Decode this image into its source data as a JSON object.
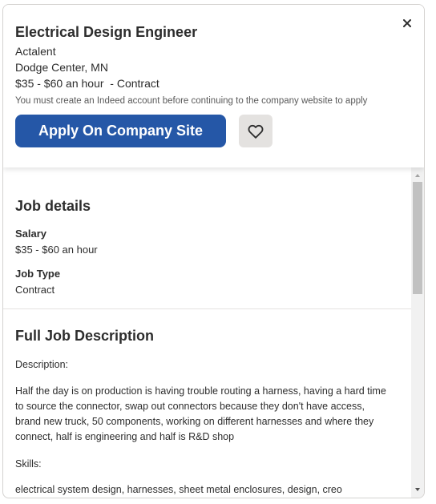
{
  "job": {
    "title": "Electrical Design Engineer",
    "company": "Actalent",
    "location": "Dodge Center, MN",
    "pay_line": "$35 - $60 an hour  - Contract",
    "account_note": "You must create an Indeed account before continuing to the company website to apply",
    "apply_label": "Apply On Company Site"
  },
  "details": {
    "heading": "Job details",
    "salary_label": "Salary",
    "salary_value": "$35 - $60 an hour",
    "type_label": "Job Type",
    "type_value": "Contract"
  },
  "description": {
    "heading": "Full Job Description",
    "p1": "Description:",
    "p2": "Half the day is on production is having trouble routing a harness, having a hard time to source the connector, swap out connectors because they don't have access, brand new truck, 50 components, working on different harnesses and where they connect, half is engineering and half is R&D shop",
    "p3": "Skills:",
    "p4": "electrical system design, harnesses, sheet metal enclosures, design, creo"
  },
  "colors": {
    "apply_button": "#2557a7",
    "save_button": "#e4e2e0"
  },
  "icons": {
    "close": "close-icon",
    "save": "heart-icon",
    "scroll_up": "triangle-up",
    "scroll_down": "triangle-down"
  }
}
